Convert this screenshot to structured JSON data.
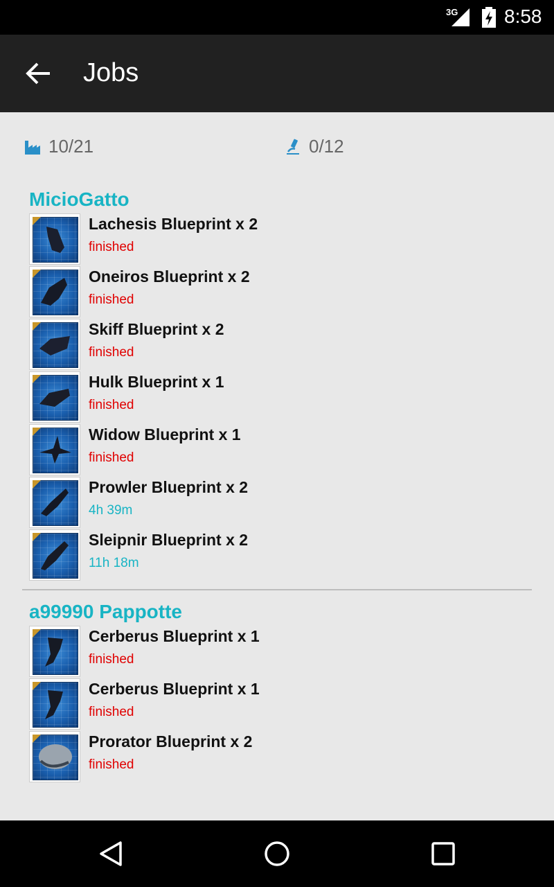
{
  "status_bar": {
    "network": "3G",
    "time": "8:58"
  },
  "toolbar": {
    "title": "Jobs",
    "back_icon": "arrow-left-icon"
  },
  "summary": {
    "manufacturing": {
      "icon": "factory-icon",
      "value": "10/21"
    },
    "research": {
      "icon": "microscope-icon",
      "value": "0/12"
    }
  },
  "groups": [
    {
      "name": "MicioGatto",
      "jobs": [
        {
          "name": "Lachesis Blueprint x 2",
          "status": "finished"
        },
        {
          "name": "Oneiros Blueprint x 2",
          "status": "finished"
        },
        {
          "name": "Skiff Blueprint x 2",
          "status": "finished"
        },
        {
          "name": "Hulk Blueprint x 1",
          "status": "finished"
        },
        {
          "name": "Widow Blueprint x 1",
          "status": "finished"
        },
        {
          "name": "Prowler Blueprint x 2",
          "status": "4h 39m"
        },
        {
          "name": "Sleipnir Blueprint x 2",
          "status": "11h 18m"
        }
      ]
    },
    {
      "name": "a99990 Pappotte",
      "jobs": [
        {
          "name": "Cerberus Blueprint x 1",
          "status": "finished"
        },
        {
          "name": "Cerberus Blueprint x 1",
          "status": "finished"
        },
        {
          "name": "Prorator Blueprint x 2",
          "status": "finished"
        }
      ]
    }
  ],
  "colors": {
    "accent": "#18b4c4",
    "finished": "#e00000",
    "toolbar": "#212121"
  },
  "nav_bar": {
    "back": "triangle-back-icon",
    "home": "circle-home-icon",
    "recents": "square-recents-icon"
  }
}
